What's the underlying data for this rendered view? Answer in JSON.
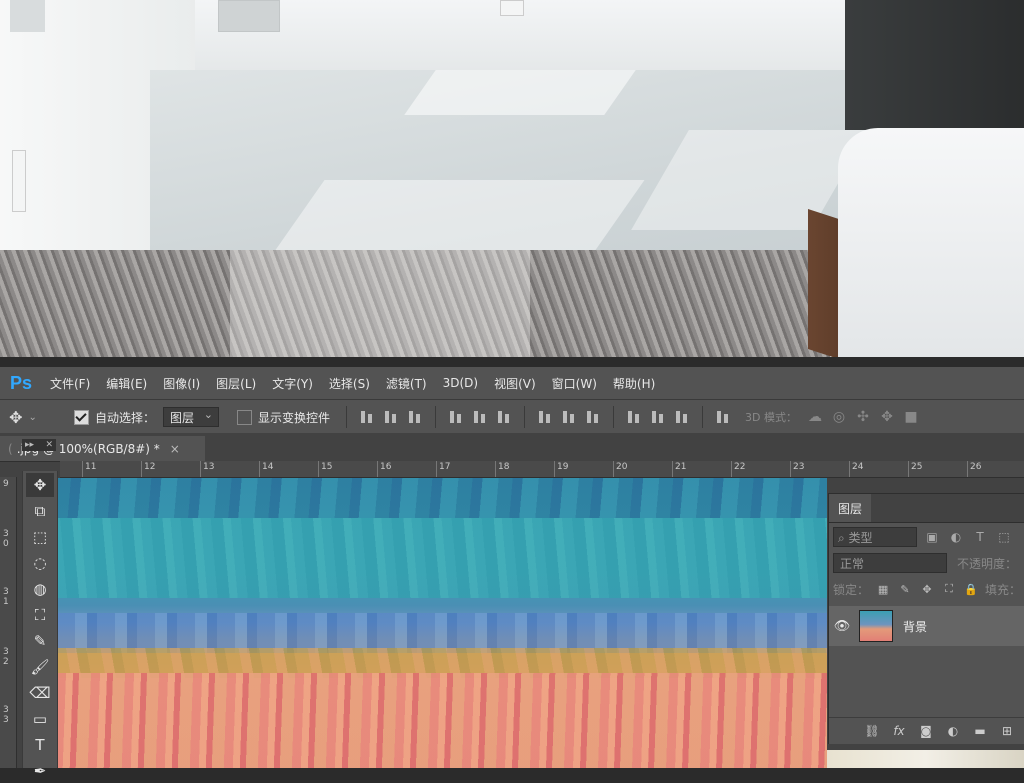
{
  "menubar": {
    "logo": "Ps",
    "items": [
      "文件(F)",
      "编辑(E)",
      "图像(I)",
      "图层(L)",
      "文字(Y)",
      "选择(S)",
      "滤镜(T)",
      "3D(D)",
      "视图(V)",
      "窗口(W)",
      "帮助(H)"
    ]
  },
  "options": {
    "auto_select_label": "自动选择：",
    "auto_select_value": "图层",
    "show_transform_label": "显示变换控件",
    "mode_label": "3D 模式："
  },
  "document": {
    "tab_title": ".jpg @ 100%(RGB/8#) *",
    "tab_close": "×"
  },
  "rulers": {
    "top": [
      "11",
      "12",
      "13",
      "14",
      "15",
      "16",
      "17",
      "18",
      "19",
      "20",
      "21",
      "22",
      "23",
      "24",
      "25",
      "26"
    ],
    "left": [
      "9",
      "3 0",
      "3 1",
      "3 2",
      "3 3"
    ]
  },
  "tools": [
    {
      "name": "move-tool",
      "glyph": "✥"
    },
    {
      "name": "artboard-tool",
      "glyph": "⧉"
    },
    {
      "name": "marquee-tool",
      "glyph": "⬚"
    },
    {
      "name": "lasso-tool",
      "glyph": "◌"
    },
    {
      "name": "quick-select-tool",
      "glyph": "◍"
    },
    {
      "name": "crop-tool",
      "glyph": "⛶"
    },
    {
      "name": "eyedropper-tool",
      "glyph": "✎"
    },
    {
      "name": "brush-tool",
      "glyph": "🖌"
    },
    {
      "name": "eraser-tool",
      "glyph": "⌫"
    },
    {
      "name": "gradient-tool",
      "glyph": "▭"
    },
    {
      "name": "type-tool",
      "glyph": "T"
    },
    {
      "name": "pen-tool",
      "glyph": "✒"
    }
  ],
  "layers_panel": {
    "tab": "图层",
    "kind_placeholder": "⌕ 类型",
    "blend_mode": "正常",
    "opacity_label": "不透明度：",
    "lock_label": "锁定：",
    "fill_label": "填充：",
    "layer_name": "背景"
  },
  "colors": {
    "ps_accent": "#31a8ff",
    "panel_bg": "#535353",
    "app_bg": "#424242"
  }
}
